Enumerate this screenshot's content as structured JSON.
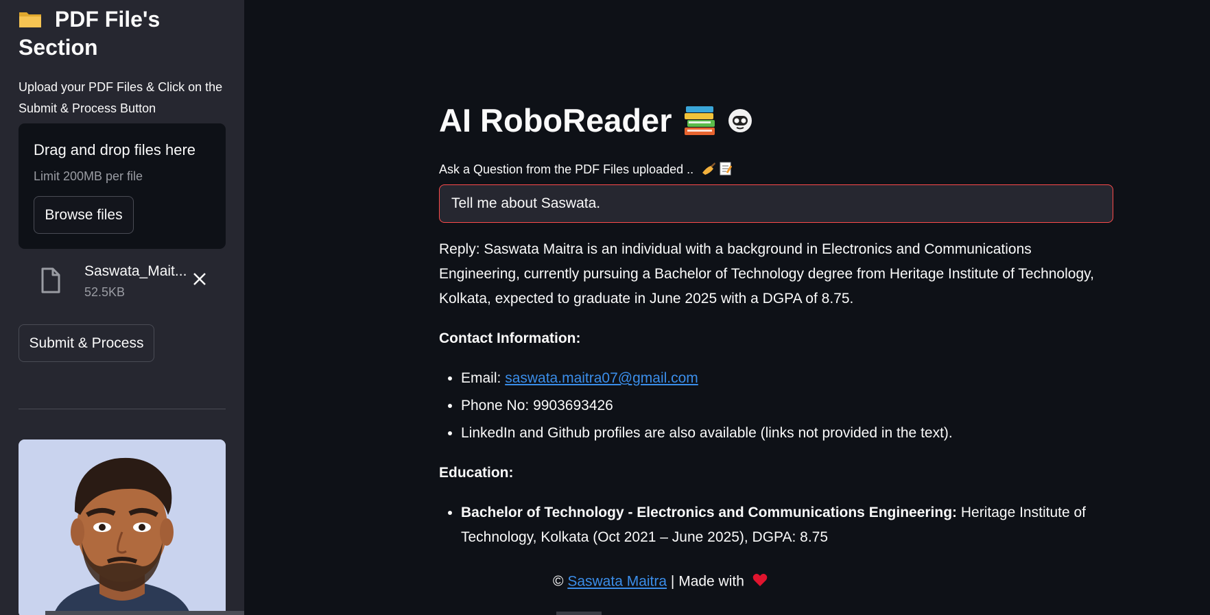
{
  "sidebar": {
    "title_line1": "PDF File's",
    "title_line2": "Section",
    "title_icon": "folder-icon",
    "description": "Upload your PDF Files & Click on the Submit & Process Button",
    "dropzone": {
      "title": "Drag and drop files here",
      "limit": "Limit 200MB per file",
      "browse_label": "Browse files"
    },
    "file": {
      "name": "Saswata_Mait...",
      "size": "52.5KB"
    },
    "submit_label": "Submit & Process"
  },
  "main": {
    "title": "AI RoboReader",
    "title_icons": [
      "books-icon",
      "robot-icon"
    ],
    "question_label": "Ask a Question from the PDF Files uploaded ..",
    "question_label_icons": [
      "writing-hand-icon",
      "memo-icon"
    ],
    "question_value": "Tell me about Saswata.",
    "reply": {
      "intro": "Reply: Saswata Maitra is an individual with a background in Electronics and Communications Engineering, currently pursuing a Bachelor of Technology degree from Heritage Institute of Technology, Kolkata, expected to graduate in June 2025 with a DGPA of 8.75.",
      "contact_heading": "Contact Information:",
      "email_label": "Email:",
      "email": "saswata.maitra07@gmail.com",
      "phone": "Phone No: 9903693426",
      "profiles": "LinkedIn and Github profiles are also available (links not provided in the text).",
      "education_heading": "Education:",
      "education_degree": "Bachelor of Technology - Electronics and Communications Engineering:",
      "education_detail": "Heritage Institute of Technology, Kolkata (Oct 2021 – June 2025), DGPA: 8.75"
    },
    "footer": {
      "copyright": "©",
      "author": "Saswata Maitra",
      "made_with": "| Made with"
    }
  },
  "colors": {
    "background": "#0e1117",
    "sidebar": "#262730",
    "accent_red": "#ff4b4b",
    "link": "#3b8eea"
  }
}
